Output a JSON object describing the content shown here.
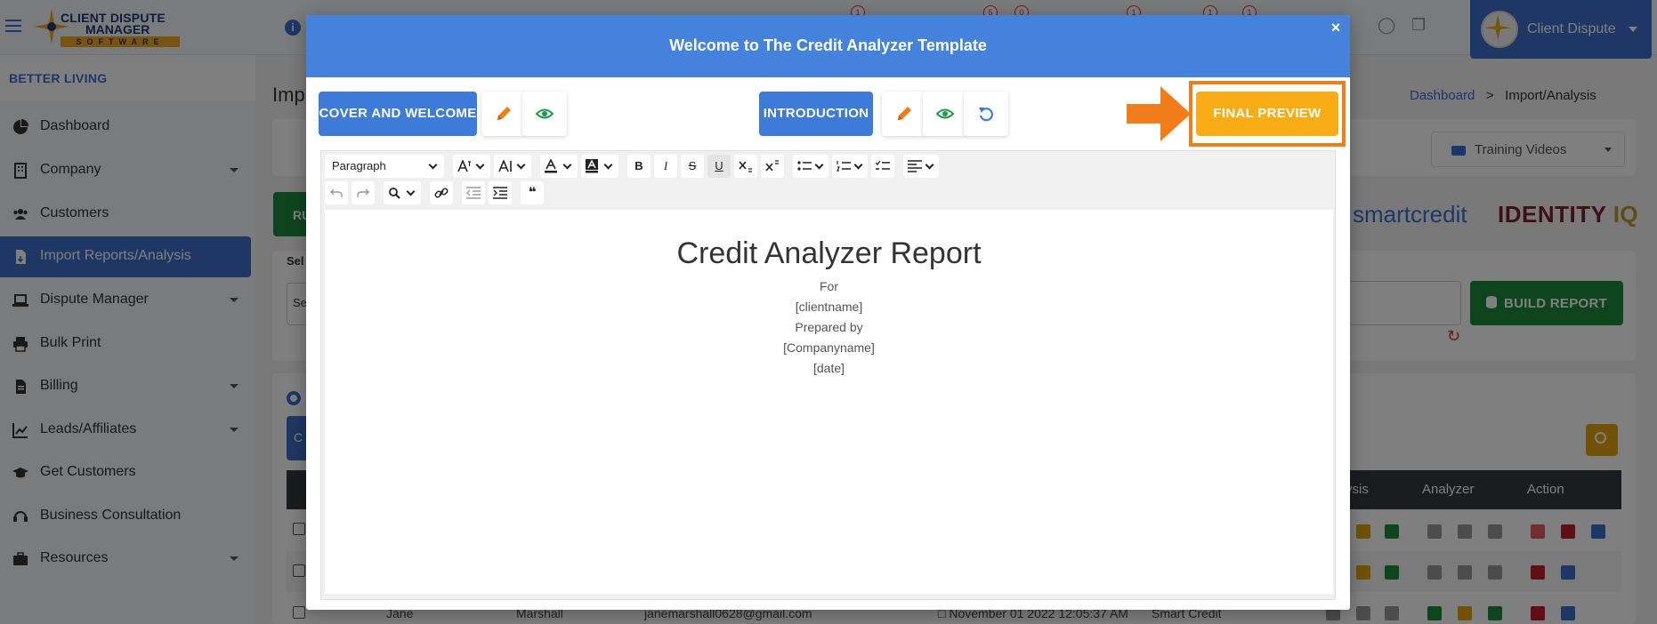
{
  "header": {
    "logo_line1": "CLIENT DISPUTE",
    "logo_line2": "MANAGER",
    "logo_line3": "SOFTWARE",
    "notification_counts": [
      "1",
      "5",
      "0",
      "1",
      "1",
      "1"
    ],
    "user_name": "Client Dispute"
  },
  "sidebar": {
    "brand": "BETTER LIVING",
    "items": [
      {
        "label": "Dashboard",
        "has_submenu": false,
        "active": false
      },
      {
        "label": "Company",
        "has_submenu": true,
        "active": false
      },
      {
        "label": "Customers",
        "has_submenu": false,
        "active": false
      },
      {
        "label": "Import Reports/Analysis",
        "has_submenu": false,
        "active": true
      },
      {
        "label": "Dispute Manager",
        "has_submenu": true,
        "active": false
      },
      {
        "label": "Bulk Print",
        "has_submenu": false,
        "active": false
      },
      {
        "label": "Billing",
        "has_submenu": true,
        "active": false
      },
      {
        "label": "Leads/Affiliates",
        "has_submenu": true,
        "active": false
      },
      {
        "label": "Get Customers",
        "has_submenu": false,
        "active": false
      },
      {
        "label": "Business Consultation",
        "has_submenu": false,
        "active": false
      },
      {
        "label": "Resources",
        "has_submenu": true,
        "active": false
      }
    ]
  },
  "background": {
    "page_title": "Imp",
    "breadcrumb": {
      "home": "Dashboard",
      "current": "Import/Analysis"
    },
    "training_videos": "Training Videos",
    "green_btn_partial": "RU",
    "select_label_partial": "Sel",
    "select_value_partial": "Se",
    "tab_partial": "C",
    "smartcredit": "smartcredit",
    "identity_a": "IDENTITY ",
    "identity_b": "IQ",
    "build_report": "BUILD REPORT",
    "table_headers": {
      "analysis_partial": "ysis",
      "analyzer": "Analyzer",
      "action": "Action"
    },
    "row": {
      "first_name": "Jane",
      "last_name": "Marshall",
      "email": "janemarshall0628@gmail.com",
      "date": "November 01 2022 12:05:37 AM",
      "source": "Smart Credit"
    }
  },
  "modal": {
    "title": "Welcome to The Credit Analyzer Template",
    "close": "×",
    "buttons": {
      "cover": "COVER AND WELCOME",
      "introduction": "INTRODUCTION",
      "final_preview": "FINAL PREVIEW"
    },
    "toolbar": {
      "paragraph": "Paragraph",
      "bold": "B",
      "italic": "I",
      "strike": "S",
      "underline": "U",
      "quote": "❝"
    },
    "document": {
      "title": "Credit Analyzer Report",
      "lines": [
        "For",
        "[clientname]",
        "Prepared by",
        "[Companyname]",
        "[date]"
      ]
    }
  },
  "colors": {
    "primary": "#3e7bd8",
    "modal_header": "#4582dc",
    "accent_orange": "#f8ad16",
    "highlight": "#f07c1a",
    "success": "#1f8a3c"
  }
}
